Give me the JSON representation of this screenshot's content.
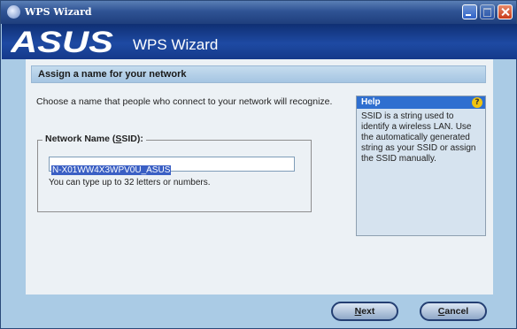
{
  "window": {
    "title": "WPS Wizard"
  },
  "banner": {
    "logo_text": "ASUS",
    "title": "WPS Wizard"
  },
  "section": {
    "title": "Assign a name for your network"
  },
  "description": "Choose a name that people who connect to your network will recognize.",
  "ssid_group": {
    "legend_prefix": "Network Name (",
    "legend_accel": "S",
    "legend_suffix": "SID):",
    "value": "N-X01WW4X3WPV0U_ASUS",
    "note": "You can type up to 32 letters or numbers."
  },
  "help": {
    "title": "Help",
    "icon": "question-mark-icon",
    "text": "SSID is a string used to identify a wireless LAN. Use the automatically generated string as your SSID or assign the SSID manually."
  },
  "buttons": {
    "next_accel": "N",
    "next_rest": "ext",
    "cancel_accel": "C",
    "cancel_rest": "ancel"
  },
  "colors": {
    "titlebar": "#2f5394",
    "banner": "#1e4aa3",
    "frame": "#aacbe5",
    "help_header": "#2f6fd0",
    "selection": "#3a5fc4"
  }
}
